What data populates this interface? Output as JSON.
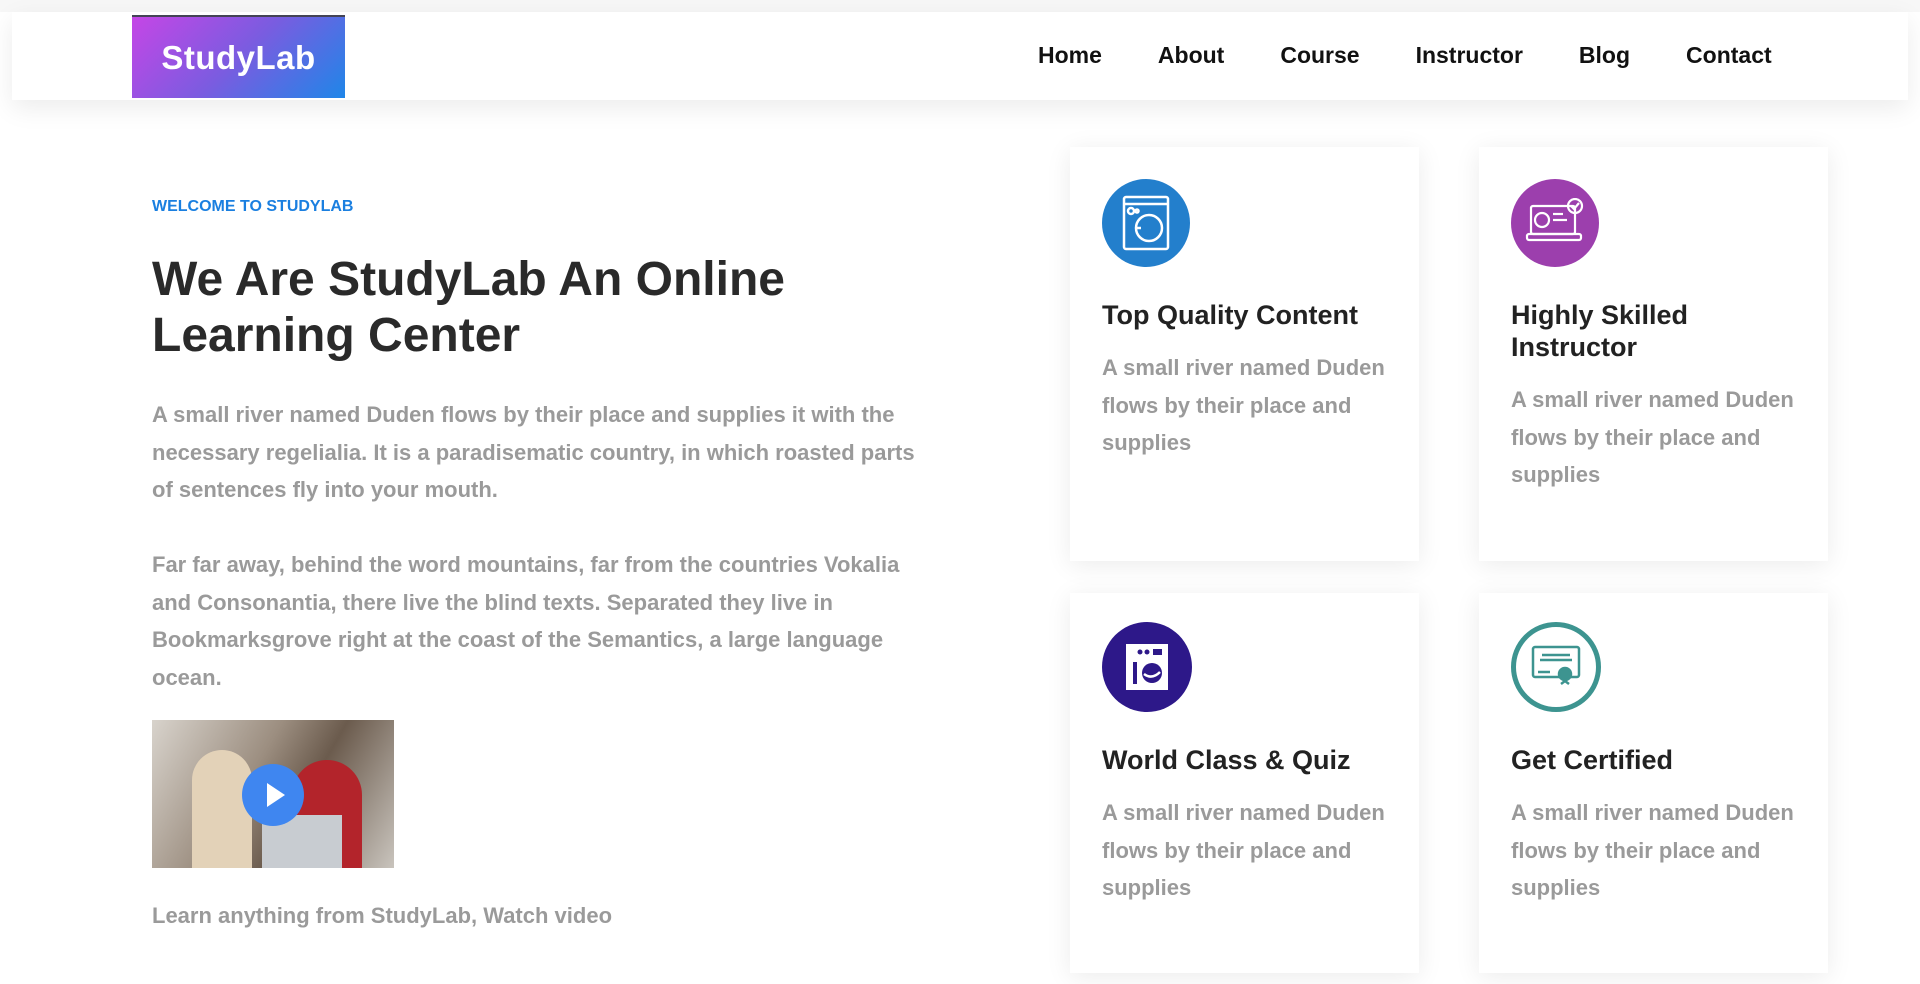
{
  "header": {
    "logo": "StudyLab",
    "nav": [
      "Home",
      "About",
      "Course",
      "Instructor",
      "Blog",
      "Contact"
    ]
  },
  "hero": {
    "kicker": "WELCOME TO STUDYLAB",
    "title": "We Are StudyLab An Online Learning Center",
    "p1": "A small river named Duden flows by their place and supplies it with the necessary regelialia. It is a paradisematic country, in which roasted parts of sentences fly into your mouth.",
    "p2": "Far far away, behind the word mountains, far from the countries Vokalia and Consonantia, there live the blind texts. Separated they live in Bookmarksgrove right at the coast of the Semantics, a large language ocean.",
    "caption": "Learn anything from StudyLab, Watch video"
  },
  "cards": [
    {
      "title": "Top Quality Content",
      "text": "A small river named Duden flows by their place and supplies",
      "icon": "washing-machine-icon",
      "color": "#237fcc"
    },
    {
      "title": "Highly Skilled Instructor",
      "text": "A small river named Duden flows by their place and supplies",
      "icon": "laptop-profile-icon",
      "color": "#9c3fad"
    },
    {
      "title": "World Class & Quiz",
      "text": "A small river named Duden flows by their place and supplies",
      "icon": "washer-icon",
      "color": "#2d1889"
    },
    {
      "title": "Get Certified",
      "text": "A small river named Duden flows by their place and supplies",
      "icon": "certificate-icon",
      "color": "#3d9490"
    }
  ]
}
